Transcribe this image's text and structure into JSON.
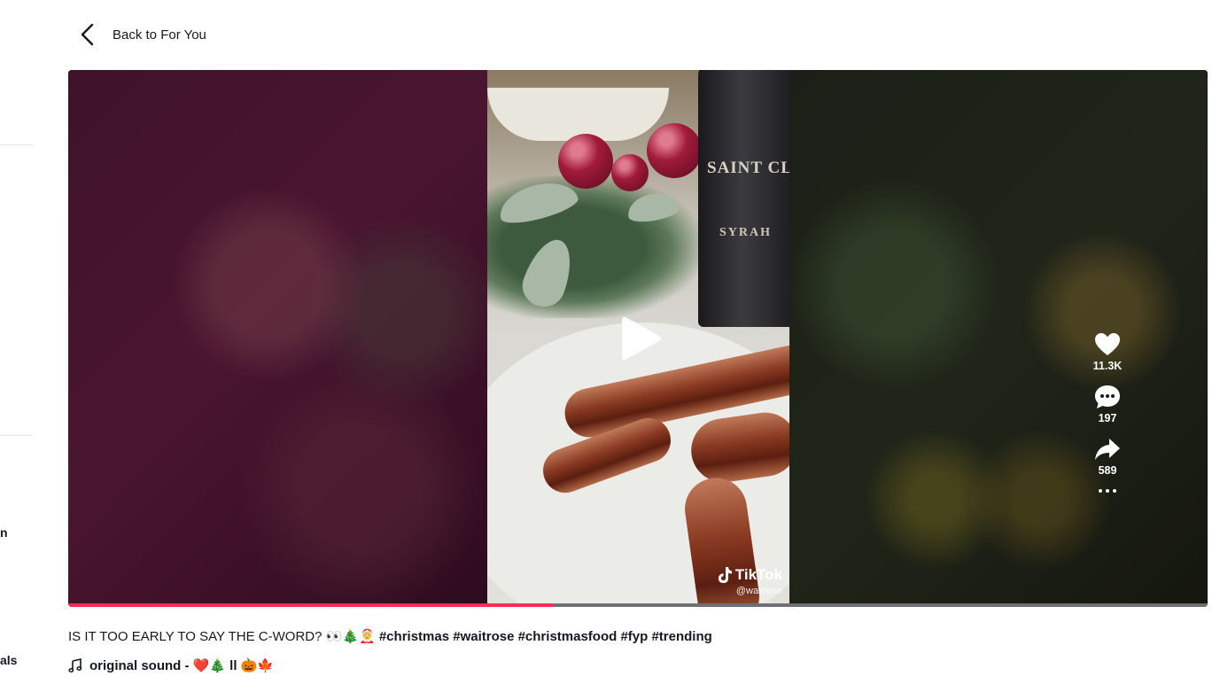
{
  "nav": {
    "back_label": "Back to For You"
  },
  "sidebar": {
    "partial_labels": [
      "n",
      "als"
    ]
  },
  "video": {
    "bottle_label_line1": "SAINT CLAIR",
    "bottle_label_line2": "SYRAH",
    "watermark_brand": "TikTok",
    "watermark_user": "@waitrose",
    "progress": 0.425
  },
  "actions": {
    "likes": "11.3K",
    "comments": "197",
    "shares": "589"
  },
  "caption": {
    "text": "IS IT TOO EARLY TO SAY THE C-WORD? 👀🎄🤶",
    "hashtags": "#christmas #waitrose #christmasfood #fyp #trending"
  },
  "sound": {
    "label": "original sound - ❤️🎄 ll 🎃🍁"
  },
  "colors": {
    "accent": "#fe2c55",
    "text": "#161823"
  }
}
